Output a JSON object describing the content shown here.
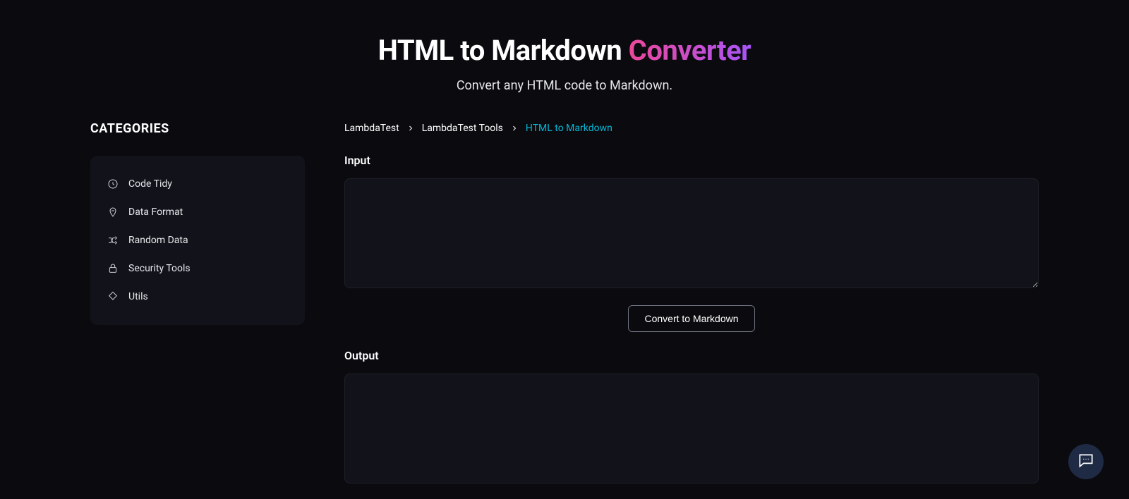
{
  "hero": {
    "title_main": "HTML to Markdown ",
    "title_accent": "Converter",
    "subtitle": "Convert any HTML code to Markdown."
  },
  "sidebar": {
    "heading": "CATEGORIES",
    "items": [
      {
        "label": "Code Tidy",
        "icon": "code-tidy-icon"
      },
      {
        "label": "Data Format",
        "icon": "data-format-icon"
      },
      {
        "label": "Random Data",
        "icon": "random-data-icon"
      },
      {
        "label": "Security Tools",
        "icon": "security-tools-icon"
      },
      {
        "label": "Utils",
        "icon": "utils-icon"
      }
    ]
  },
  "breadcrumb": {
    "items": [
      {
        "label": "LambdaTest",
        "current": false
      },
      {
        "label": "LambdaTest Tools",
        "current": false
      },
      {
        "label": "HTML to Markdown",
        "current": true
      }
    ]
  },
  "input": {
    "label": "Input",
    "value": "",
    "placeholder": ""
  },
  "convert_button": {
    "label": "Convert to Markdown"
  },
  "output": {
    "label": "Output",
    "value": ""
  },
  "chat": {
    "aria": "Open chat"
  },
  "colors": {
    "bg": "#0a0a0f",
    "panel": "#12131a",
    "accent_start": "#ec4899",
    "accent_end": "#a855f7",
    "link_current": "#06b6d4"
  }
}
